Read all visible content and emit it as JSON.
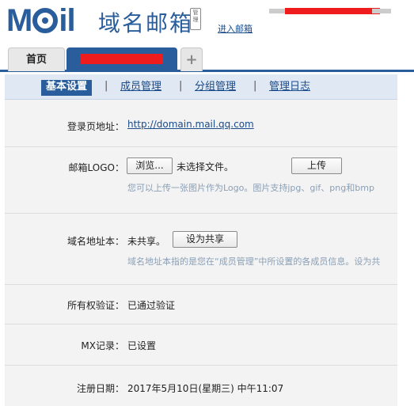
{
  "header": {
    "logo": "MOil",
    "product_name": "域名邮箱",
    "admin_badge": "管理",
    "enter_mail": "进入邮箱"
  },
  "tabs": [
    {
      "label": "首页"
    },
    {
      "label": ""
    },
    {
      "label": "+"
    }
  ],
  "subnav": {
    "items": [
      "基本设置",
      "成员管理",
      "分组管理",
      "管理日志"
    ],
    "separator": "|"
  },
  "settings": {
    "login_page": {
      "label": "登录页地址：",
      "value": "http://domain.mail.qq.com"
    },
    "logo": {
      "label": "邮箱LOGO：",
      "browse_button": "浏览...",
      "file_status": "未选择文件。",
      "upload_button": "上传",
      "hint": "您可以上传一张图片作为Logo。图片支持jpg、gif、png和bmp"
    },
    "address_book": {
      "label": "域名地址本：",
      "value": "未共享。",
      "share_button": "设为共享",
      "hint": "域名地址本指的是您在“成员管理”中所设置的各成员信息。设为共"
    },
    "ownership": {
      "label": "所有权验证：",
      "value": "已通过验证"
    },
    "mx": {
      "label": "MX记录：",
      "value": "已设置"
    },
    "registered": {
      "label": "注册日期：",
      "value": "2017年5月10日(星期三) 中午11:07"
    }
  },
  "colors": {
    "brand": "#2a5d9b",
    "redaction": "#ee1c1c",
    "hint": "#8a9fb6"
  }
}
